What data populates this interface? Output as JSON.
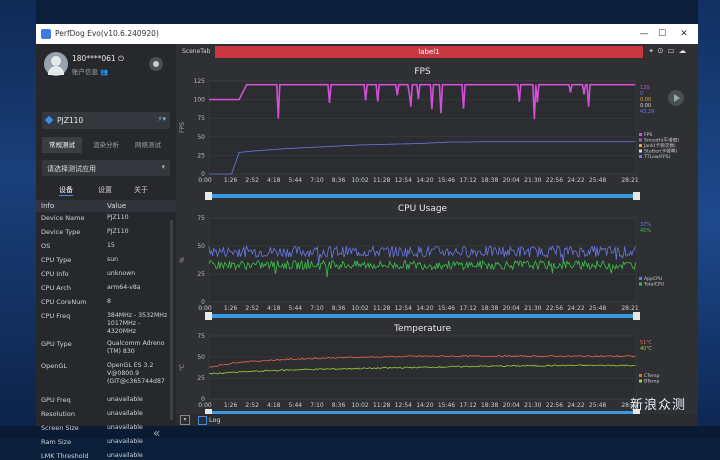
{
  "window": {
    "title": "PerfDog Evo(v10.6.240920)"
  },
  "user": {
    "id": "180****061",
    "account_label": "账户信息"
  },
  "device": {
    "name": "PJZ110"
  },
  "sidebar_tabs": [
    {
      "label": "常规测试"
    },
    {
      "label": "渲染分析"
    },
    {
      "label": "网络测试"
    }
  ],
  "app_select": {
    "placeholder": "请选择测试应用"
  },
  "subtabs": [
    {
      "label": "设备"
    },
    {
      "label": "设置"
    },
    {
      "label": "关于"
    }
  ],
  "info_table": {
    "headers": [
      "Info",
      "Value"
    ],
    "rows": [
      {
        "key": "Device Name",
        "value": "PJZ110"
      },
      {
        "key": "Device Type",
        "value": "PJZ110"
      },
      {
        "key": "OS",
        "value": "15"
      },
      {
        "key": "CPU Type",
        "value": "sun"
      },
      {
        "key": "CPU Info",
        "value": "unknown"
      },
      {
        "key": "CPU Arch",
        "value": "arm64-v8a"
      },
      {
        "key": "CPU CoreNum",
        "value": "8"
      },
      {
        "key": "CPU Freq",
        "value": "384MHz - 3532MHz\n1017MHz -\n4320MHz"
      },
      {
        "key": "GPU Type",
        "value": "Qualcomm Adreno\n(TM) 830"
      },
      {
        "key": "OpenGL",
        "value": "OpenGL ES 3.2\nV@0800.9\n(GIT@c365744d87"
      },
      {
        "key": "GPU Freq",
        "value": "unavailable"
      },
      {
        "key": "Resolution",
        "value": "unavailable"
      },
      {
        "key": "Screen Size",
        "value": "unavailable"
      },
      {
        "key": "Ram Size",
        "value": "unavailable"
      },
      {
        "key": "LMK Threshold",
        "value": "unavailable"
      }
    ]
  },
  "scene": {
    "tab_label": "SceneTab",
    "label": "label1"
  },
  "bottom": {
    "log_label": "Log"
  },
  "watermark": "新浪众测",
  "colors": {
    "fps": "#d24fd6",
    "jank": "#e8a23a",
    "cpu_app": "#6b78e6",
    "cpu_total": "#3cc24a",
    "temp_cpu": "#e36a43",
    "temp_bat": "#9bd337",
    "label_bar": "#c8373f",
    "accent": "#3b8de8"
  },
  "chart_data": [
    {
      "type": "line",
      "title": "FPS",
      "ylabel": "FPS",
      "ylim": [
        0,
        125
      ],
      "yticks": [
        "125",
        "100",
        "75",
        "50",
        "25",
        "0"
      ],
      "xticks": [
        "0:00",
        "1:26",
        "2:52",
        "4:18",
        "5:44",
        "7:10",
        "8:36",
        "10:02",
        "11:28",
        "12:54",
        "14:20",
        "15:46",
        "17:12",
        "18:38",
        "20:04",
        "21:30",
        "22:56",
        "24:22",
        "25:48",
        "28:21"
      ],
      "current_values": [
        "120",
        "0",
        "0.00",
        "0.00",
        "43.29"
      ],
      "legend": [
        "FPS",
        "Smooth(平滑度)",
        "Jank(卡顿次数)",
        "Stutter(卡顿率)",
        "TTLow(FPS)"
      ],
      "series": [
        {
          "name": "FPS",
          "x": [
            0,
            0.5,
            1.0,
            1.5,
            2.0,
            2.5,
            3.0,
            4.0,
            6.0,
            8.0,
            10.0,
            12.0,
            14.0,
            15.5,
            16.0,
            18.0,
            20.0,
            22.0,
            24.0,
            26.0,
            28.3
          ],
          "y": [
            100,
            100,
            100,
            100,
            100,
            120,
            120,
            120,
            120,
            120,
            120,
            120,
            120,
            120,
            120,
            120,
            120,
            120,
            120,
            120,
            120
          ]
        },
        {
          "name": "TTLow(FPS)",
          "x": [
            0,
            1.5,
            2.0,
            3.0,
            5.0,
            8.0,
            10.0,
            12.0,
            14.0,
            15.0,
            16.0,
            17.0,
            18.0
          ],
          "y": [
            0,
            0,
            29,
            31,
            34,
            37,
            39,
            40,
            41,
            42,
            43,
            43,
            43.3
          ]
        }
      ]
    },
    {
      "type": "line",
      "title": "CPU Usage",
      "ylabel": "%",
      "ylim": [
        0,
        75
      ],
      "yticks": [
        "75",
        "50",
        "25",
        "0"
      ],
      "xticks": [
        "0:00",
        "1:26",
        "2:52",
        "4:18",
        "5:44",
        "7:10",
        "8:36",
        "10:02",
        "11:28",
        "12:54",
        "14:20",
        "15:46",
        "17:12",
        "18:38",
        "20:04",
        "21:30",
        "22:56",
        "24:22",
        "25:48",
        "28:21"
      ],
      "current_values": [
        "37%",
        "45%"
      ],
      "legend": [
        "AppCPU",
        "TotalCPU"
      ],
      "series": [
        {
          "name": "AppCPU",
          "x": [
            0,
            28.3
          ],
          "y": [
            45,
            45
          ]
        },
        {
          "name": "TotalCPU",
          "x": [
            0,
            28.3
          ],
          "y": [
            33,
            33
          ]
        }
      ]
    },
    {
      "type": "line",
      "title": "Temperature",
      "ylabel": "℃",
      "ylim": [
        0,
        75
      ],
      "yticks": [
        "75",
        "50",
        "25",
        "0"
      ],
      "xticks": [
        "0:00",
        "1:26",
        "2:52",
        "4:18",
        "5:44",
        "7:10",
        "8:36",
        "10:02",
        "11:28",
        "12:54",
        "14:20",
        "15:46",
        "17:12",
        "18:38",
        "20:04",
        "21:30",
        "22:56",
        "24:22",
        "25:48",
        "28:21"
      ],
      "current_values": [
        "51℃",
        "40℃"
      ],
      "legend": [
        "CTemp",
        "BTemp"
      ],
      "series": [
        {
          "name": "CTemp",
          "x": [
            0,
            2,
            5,
            8,
            11,
            14,
            17,
            20,
            23,
            26,
            28.3
          ],
          "y": [
            38,
            44,
            47,
            49,
            50,
            51,
            51,
            51,
            51,
            51,
            51
          ]
        },
        {
          "name": "BTemp",
          "x": [
            0,
            3,
            6,
            9,
            12,
            15,
            18,
            21,
            24,
            28.3
          ],
          "y": [
            30,
            33,
            35,
            36,
            37,
            38,
            39,
            39.5,
            40,
            40
          ]
        }
      ]
    }
  ]
}
